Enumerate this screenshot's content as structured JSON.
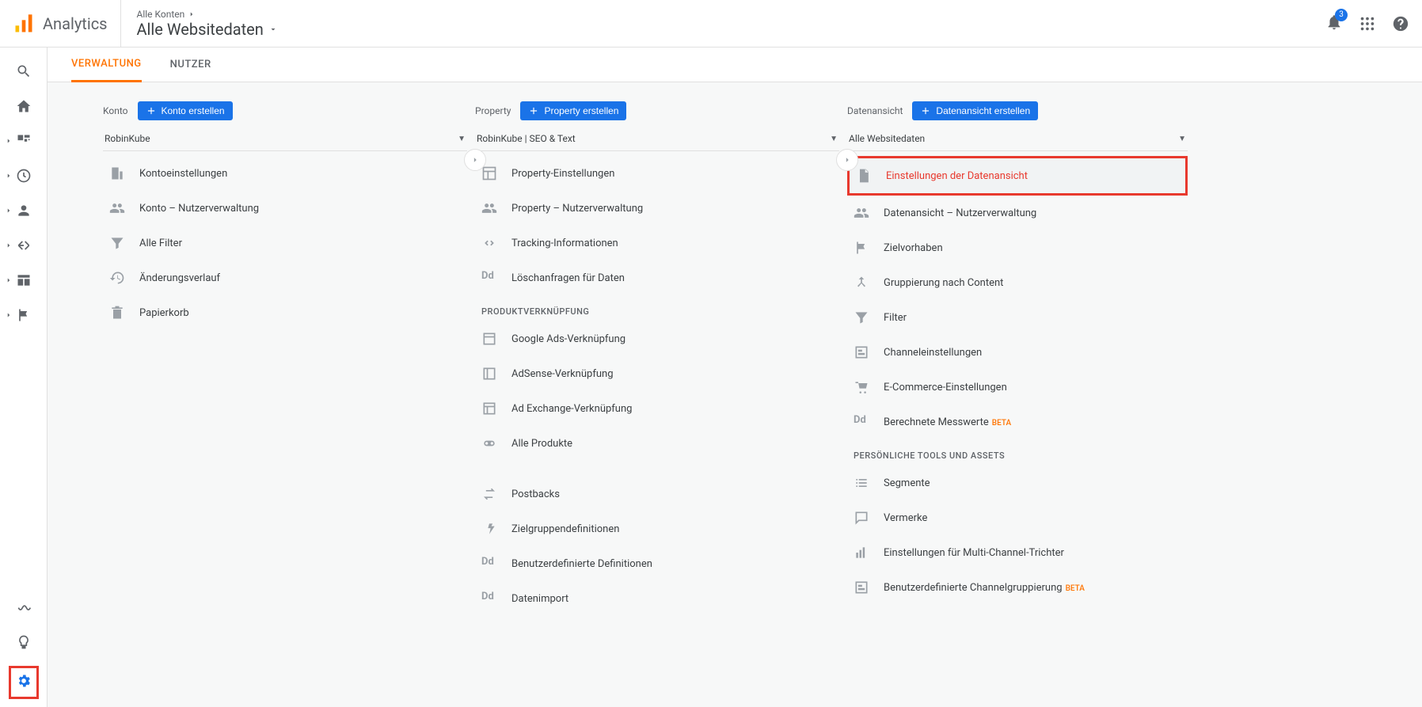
{
  "brand": "Analytics",
  "header": {
    "accounts_link": "Alle Konten",
    "view": "Alle Websitedaten",
    "notif_count": "3"
  },
  "tabs": {
    "admin": "VERWALTUNG",
    "users": "NUTZER"
  },
  "account_col": {
    "title": "Konto",
    "create": "Konto erstellen",
    "selected": "RobinKube",
    "items": [
      "Kontoeinstellungen",
      "Konto – Nutzerverwaltung",
      "Alle Filter",
      "Änderungsverlauf",
      "Papierkorb"
    ]
  },
  "property_col": {
    "title": "Property",
    "create": "Property erstellen",
    "selected": "RobinKube | SEO & Text",
    "items": [
      "Property-Einstellungen",
      "Property – Nutzerverwaltung",
      "Tracking-Informationen",
      "Löschanfragen für Daten"
    ],
    "section1": "PRODUKTVERKNÜPFUNG",
    "items2": [
      "Google Ads-Verknüpfung",
      "AdSense-Verknüpfung",
      "Ad Exchange-Verknüpfung",
      "Alle Produkte"
    ],
    "items3": [
      "Postbacks",
      "Zielgruppendefinitionen",
      "Benutzerdefinierte Definitionen",
      "Datenimport"
    ]
  },
  "view_col": {
    "title": "Datenansicht",
    "create": "Datenansicht erstellen",
    "selected": "Alle Websitedaten",
    "highlighted": "Einstellungen der Datenansicht",
    "items": [
      "Datenansicht – Nutzerverwaltung",
      "Zielvorhaben",
      "Gruppierung nach Content",
      "Filter",
      "Channeleinstellungen",
      "E-Commerce-Einstellungen"
    ],
    "beta_item": "Berechnete Messwerte",
    "beta_label": "BETA",
    "section2": "PERSÖNLICHE TOOLS UND ASSETS",
    "items2": [
      "Segmente",
      "Vermerke",
      "Einstellungen für Multi-Channel-Trichter"
    ],
    "beta_item2": "Benutzerdefinierte Channelgruppierung"
  }
}
